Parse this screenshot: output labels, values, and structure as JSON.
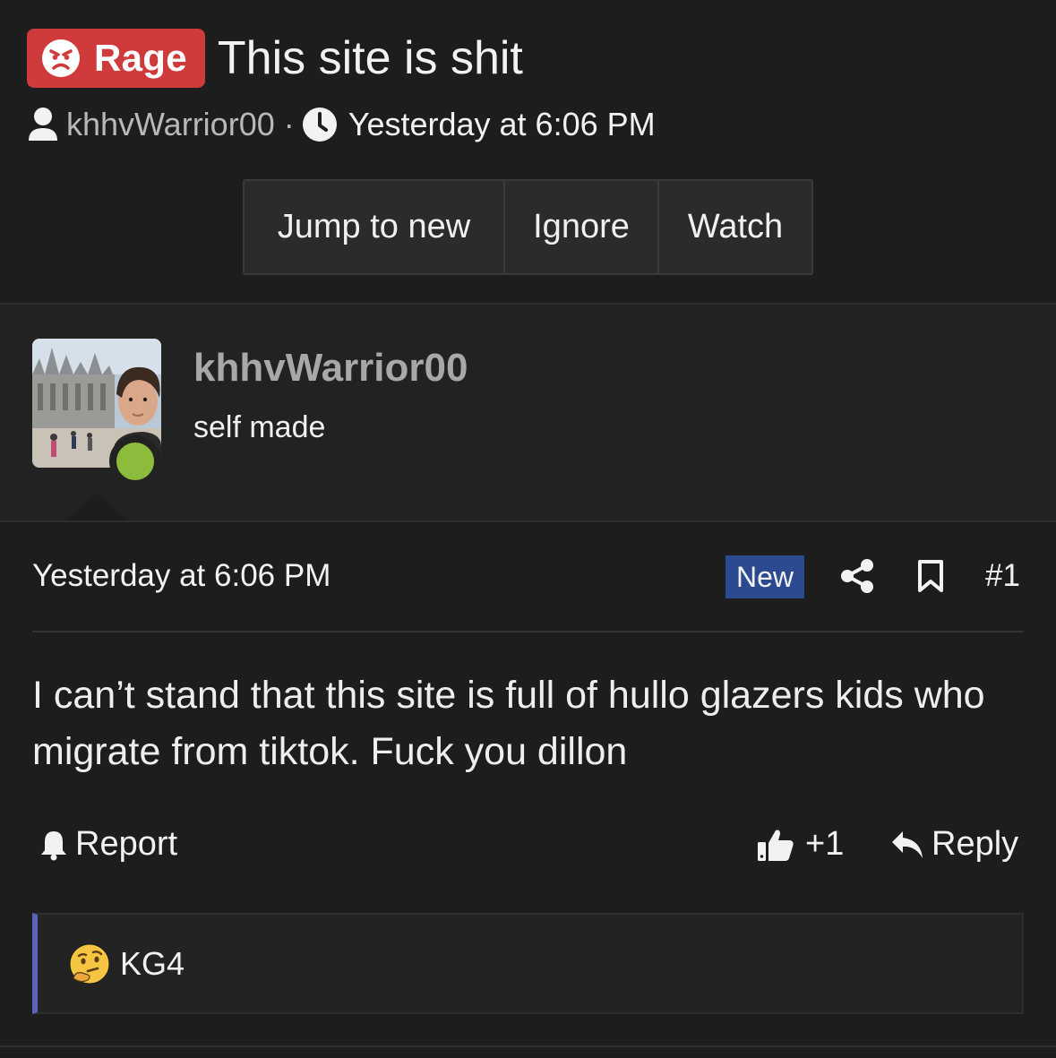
{
  "thread": {
    "prefix": "Rage",
    "title": "This site is shit",
    "author": "khhvWarrior00",
    "separator": "·",
    "time": "Yesterday at 6:06 PM"
  },
  "actions": {
    "jump_label": "Jump to new",
    "ignore_label": "Ignore",
    "watch_label": "Watch"
  },
  "post": {
    "username": "khhvWarrior00",
    "user_title": "self made",
    "date": "Yesterday at 6:06 PM",
    "new_badge": "New",
    "post_number": "#1",
    "message": "I can’t stand that this site is full of hullo glazers kids who migrate from tiktok. Fuck you dillon",
    "report_label": "Report",
    "like_count": "+1",
    "reply_label": "Reply",
    "reactions": [
      {
        "icon": "thinking-face-icon",
        "user": "KG4"
      }
    ]
  },
  "icons": {
    "prefix": "angry-face-icon",
    "author": "user-icon",
    "time": "clock-icon",
    "share": "share-icon",
    "bookmark": "bookmark-icon",
    "report": "bell-icon",
    "like": "thumbs-up-icon",
    "reply": "reply-icon"
  },
  "colors": {
    "background": "#1d1d1d",
    "rage_prefix": "#cf3b3b",
    "new_badge": "#2c4a8f",
    "online": "#8dbb3b",
    "reaction_bar": "#5b63b5"
  }
}
